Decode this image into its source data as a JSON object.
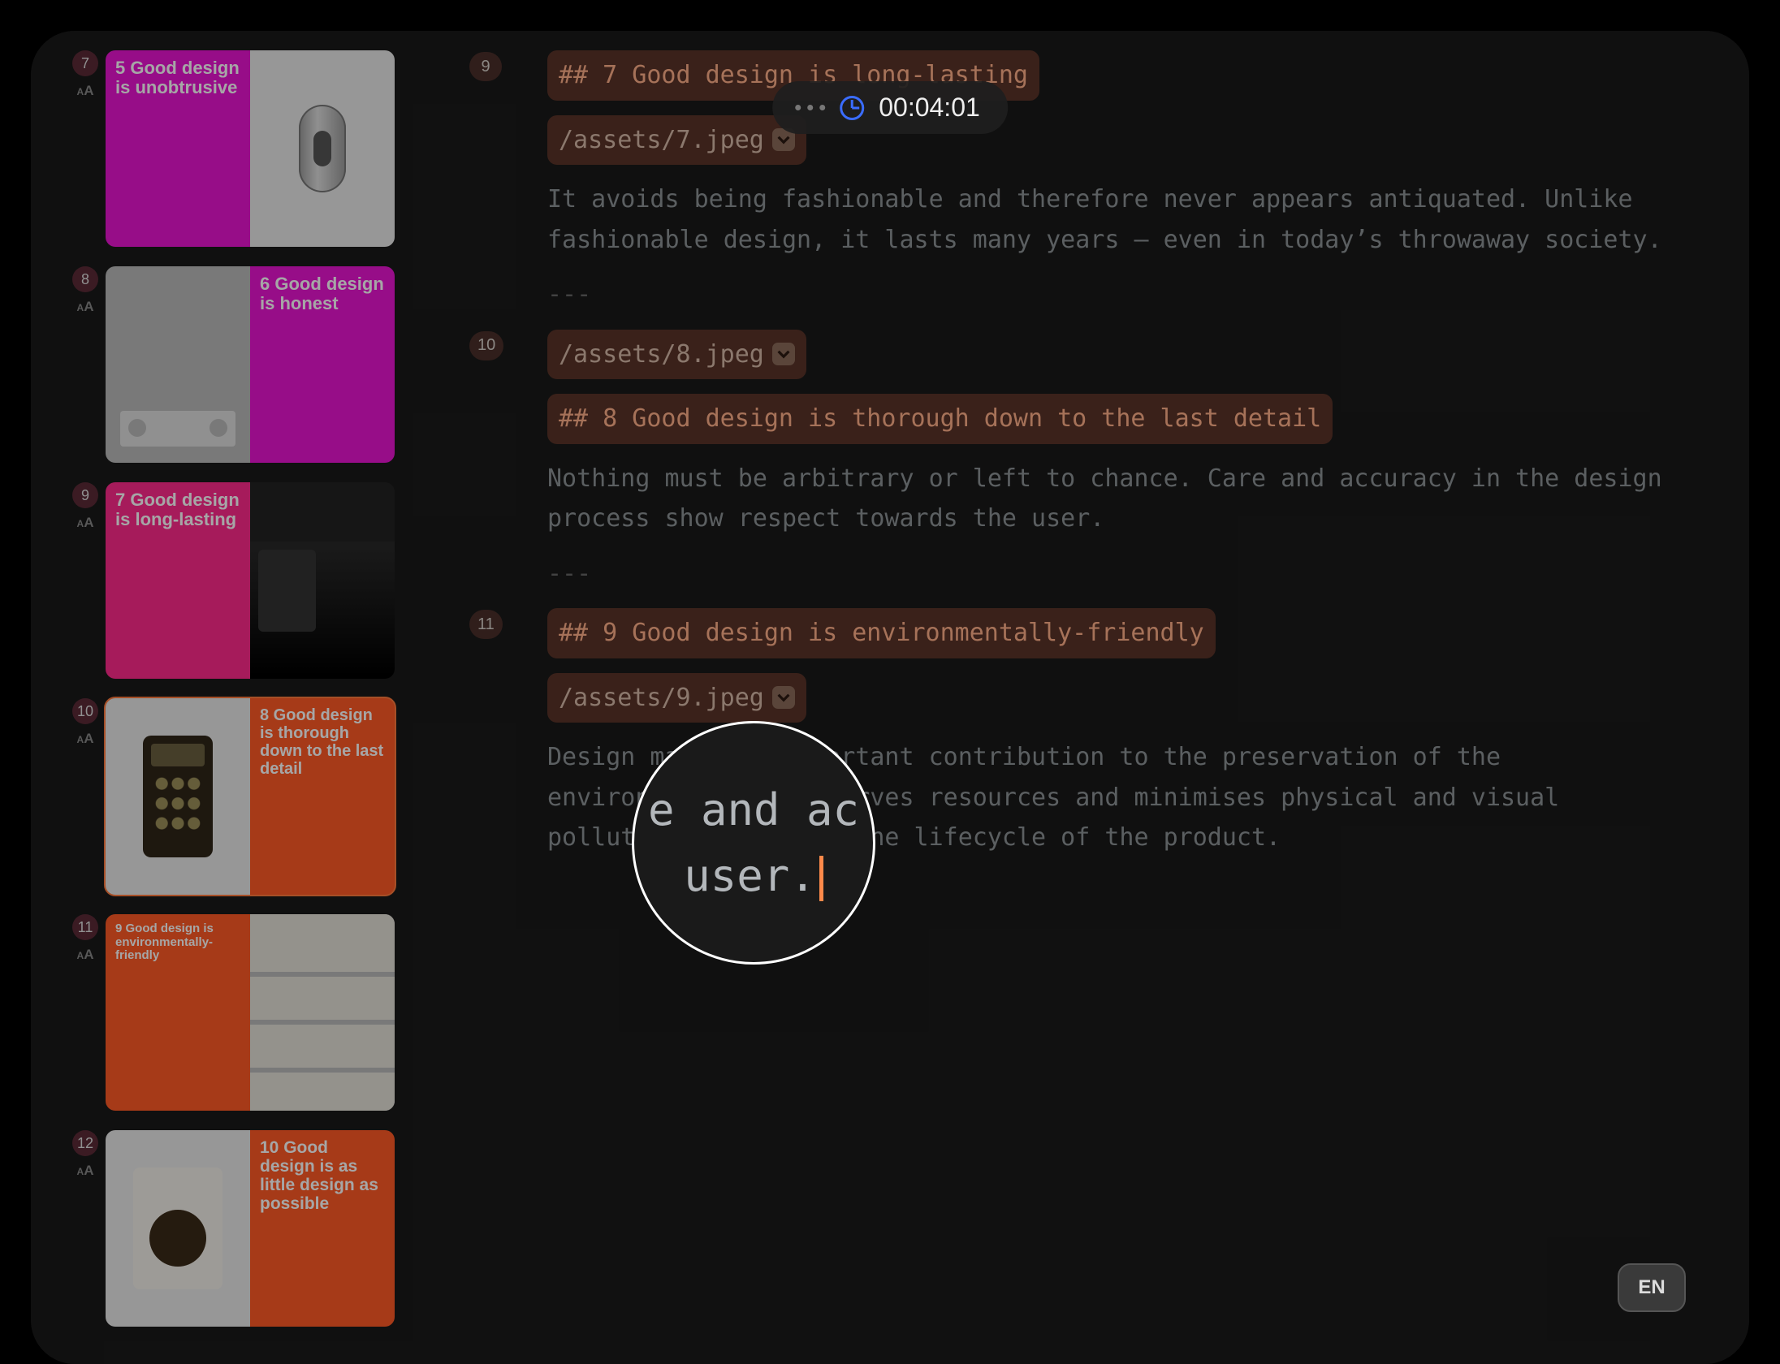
{
  "timer": {
    "value": "00:04:01"
  },
  "language_badge": "EN",
  "sidebar": {
    "slides": [
      {
        "num": "7",
        "title": "5 Good design is unobtrusive",
        "left_bg": "bg-magenta",
        "left_txt": "txt-white",
        "right_bg": "bg-white",
        "prod": "prod-cyl",
        "font": "22px",
        "selected": false
      },
      {
        "num": "8",
        "title": "6 Good design is honest",
        "left_bg": "bg-gray",
        "left_txt": "txt-black",
        "right_bg": "bg-magenta",
        "prod": "prod-radio",
        "font": "22px",
        "selected": false,
        "swap": true
      },
      {
        "num": "9",
        "title": "7 Good design is long-lasting",
        "left_bg": "bg-pink",
        "left_txt": "txt-white",
        "right_bg": "bg-dark",
        "prod": "prod-sofa",
        "font": "22px",
        "selected": false
      },
      {
        "num": "10",
        "title": "8 Good design is thorough down to the last detail",
        "left_bg": "bg-white",
        "left_txt": "txt-black",
        "right_bg": "bg-orange",
        "prod": "prod-calc",
        "font": "20px",
        "selected": true,
        "swap": true
      },
      {
        "num": "11",
        "title": "9 Good design is environmentally-friendly",
        "left_bg": "bg-orange",
        "left_txt": "txt-white",
        "right_bg": "bg-ltgray",
        "prod": "prod-shelf",
        "font": "15px",
        "selected": false
      },
      {
        "num": "12",
        "title": "10 Good design is as little design as possible",
        "left_bg": "bg-white",
        "left_txt": "txt-black",
        "right_bg": "bg-orange",
        "prod": "prod-washer",
        "font": "21px",
        "selected": false,
        "swap": true
      }
    ]
  },
  "editor": {
    "blocks": [
      {
        "num": "9",
        "type": "heading",
        "text": "## 7 Good design is long-lasting"
      },
      {
        "type": "asset",
        "text": "/assets/7.jpeg"
      },
      {
        "type": "para",
        "text": "It avoids being fashionable and therefore never appears antiquated. Unlike fashionable design, it lasts many years – even in today’s throwaway society."
      },
      {
        "type": "sep",
        "text": "---"
      },
      {
        "num": "10",
        "type": "asset",
        "text": "/assets/8.jpeg"
      },
      {
        "type": "heading",
        "text": "## 8 Good design is thorough down to the last detail"
      },
      {
        "type": "para",
        "text": "Nothing must be arbitrary or left to chance. Care and accuracy in the design process show respect towards the user."
      },
      {
        "type": "sep",
        "text": "---"
      },
      {
        "num": "11",
        "type": "heading",
        "text": "## 9 Good design is environmentally-friendly"
      },
      {
        "type": "asset",
        "text": "/assets/9.jpeg"
      },
      {
        "type": "para",
        "text": "Design makes an important contribution to the preservation of the environment. It conserves resources and minimises physical and visual pollution throughout the lifecycle of the product."
      }
    ]
  },
  "loupe": {
    "line1": "e and ac",
    "line2": "user."
  }
}
